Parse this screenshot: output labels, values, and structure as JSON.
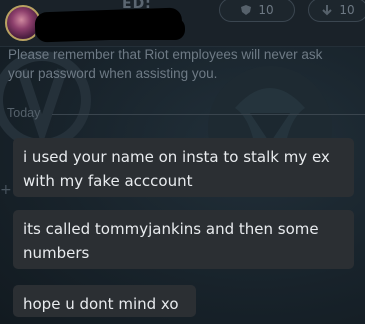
{
  "header": {
    "username_redacted": "",
    "ghost_label": "ED:",
    "stat_pill_1": "10",
    "stat_pill_2": "10"
  },
  "notice": {
    "line1": "Please remember that Riot employees will never ask",
    "line2": "your password when assisting you."
  },
  "divider": {
    "label": "Today"
  },
  "messages": [
    {
      "text": "i used your name on insta to stalk my ex with my fake acccount"
    },
    {
      "text": "its called tommyjankins and then some numbers"
    },
    {
      "text": "hope u dont mind xo"
    }
  ],
  "icons": {
    "avatar": "profile-avatar",
    "status": "online-status-icon",
    "pill_1_icon": "shield-icon",
    "pill_2_icon": "arrow-down-icon"
  },
  "colors": {
    "bubble": "#2b2f33",
    "text": "#e8ebee",
    "muted": "#6e7a85",
    "status": "#0d8ec4"
  }
}
